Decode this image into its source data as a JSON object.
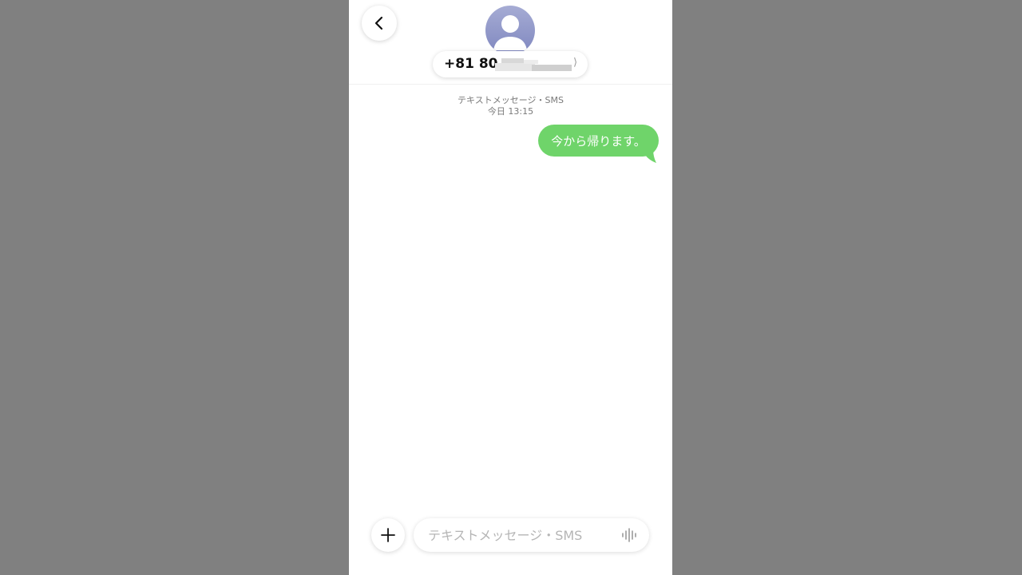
{
  "header": {
    "contact_name": "+81 80",
    "contact_chevron": "⟩",
    "back_icon": "chevron-left-icon",
    "avatar_icon": "person-avatar-icon"
  },
  "thread": {
    "channel_label": "テキストメッセージ・SMS",
    "timestamp": "今日 13:15",
    "messages": [
      {
        "text": "今から帰ります。",
        "direction": "outgoing"
      }
    ]
  },
  "composer": {
    "placeholder": "テキストメッセージ・SMS",
    "value": "",
    "add_icon": "plus-icon",
    "mic_icon": "waveform-icon"
  },
  "colors": {
    "backdrop": "#808080",
    "bubble_green": "#6fd46a",
    "avatar": "#8d94c8"
  }
}
